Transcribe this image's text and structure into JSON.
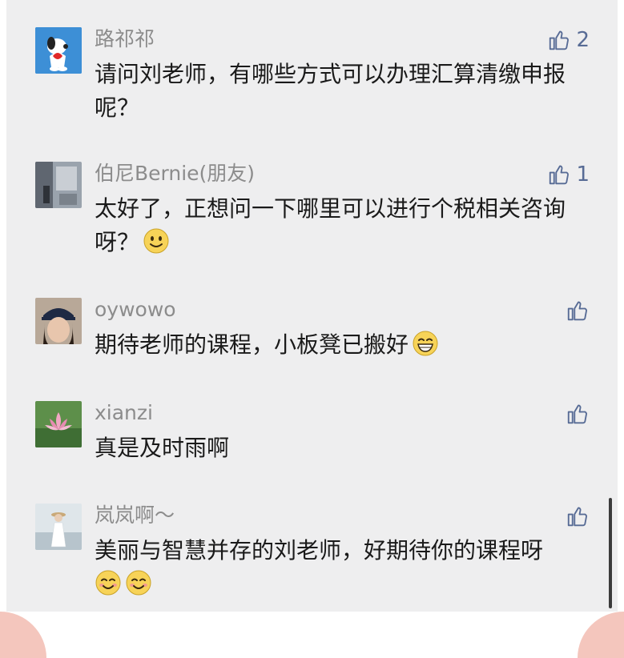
{
  "comments": [
    {
      "nickname": "路祁祁",
      "text": "请问刘老师，有哪些方式可以办理汇算清缴申报呢？",
      "likes": "2",
      "avatar": "snoopy-avatar",
      "emojis": []
    },
    {
      "nickname": "伯尼Bernie(朋友)",
      "text": "太好了，正想问一下哪里可以进行个税相关咨询呀？",
      "likes": "1",
      "avatar": "room-photo-avatar",
      "emojis": [
        "smile-emoji"
      ]
    },
    {
      "nickname": "oywowo",
      "text": "期待老师的课程，小板凳已搬好",
      "likes": "",
      "avatar": "girl-cap-avatar",
      "emojis": [
        "grin-emoji"
      ]
    },
    {
      "nickname": "xianzi",
      "text": "真是及时雨啊",
      "likes": "",
      "avatar": "lotus-avatar",
      "emojis": []
    },
    {
      "nickname": "岚岚啊～",
      "text": "美丽与智慧并存的刘老师，好期待你的课程呀",
      "likes": "",
      "avatar": "beach-girl-avatar",
      "emojis": [
        "happy-emoji",
        "happy-emoji"
      ]
    }
  ],
  "colors": {
    "nickname": "#8c8c8c",
    "link_blue": "#576b95",
    "body_text": "#1a1a1a",
    "panel_bg": "#eeeeef",
    "corner_pink": "#f4c6bd"
  },
  "icons": {
    "like": "thumbs-up-outline-icon"
  }
}
